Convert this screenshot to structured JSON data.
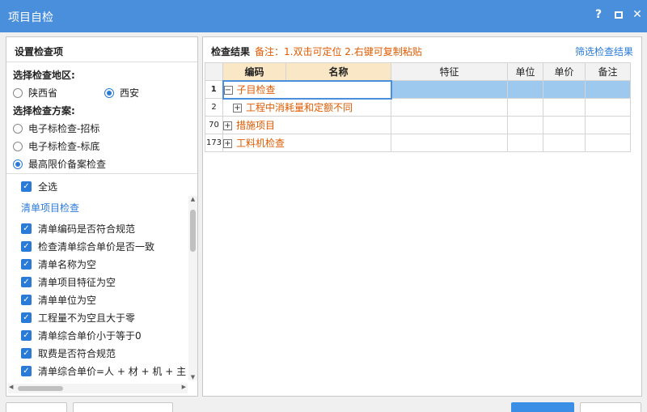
{
  "window": {
    "title": "项目自检",
    "help_label": "?",
    "close_label": "✕"
  },
  "left": {
    "title": "设置检查项",
    "region_label": "选择检查地区:",
    "regions": [
      {
        "label": "陕西省",
        "selected": false
      },
      {
        "label": "西安",
        "selected": true
      }
    ],
    "scheme_label": "选择检查方案:",
    "schemes": [
      {
        "label": "电子标检查-招标",
        "selected": false
      },
      {
        "label": "电子标检查-标底",
        "selected": false
      },
      {
        "label": "最高限价备案检查",
        "selected": true
      }
    ],
    "select_all": "全选",
    "group_title": "清单项目检查",
    "checks": [
      "清单编码是否符合规范",
      "检查清单综合单价是否一致",
      "清单名称为空",
      "清单项目特征为空",
      "清单单位为空",
      "工程量不为空且大于零",
      "清单综合单价小于等于0",
      "取费是否符合规范",
      "清单综合单价=人 + 材 + 机 + 主 +"
    ],
    "scroll_up": "▲",
    "scroll_down": "▼",
    "scroll_left": "◀",
    "scroll_right": "▶"
  },
  "right": {
    "title": "检查结果",
    "note": "备注：1.双击可定位 2.右键可复制粘贴",
    "filter_link": "筛选检查结果",
    "columns": [
      "编码",
      "名称",
      "特征",
      "单位",
      "单价",
      "备注"
    ],
    "rows": [
      {
        "num": "1",
        "sign": "−",
        "name": "子目检查"
      },
      {
        "num": "2",
        "sign": "+",
        "name": "工程中消耗量和定额不同"
      },
      {
        "num": "70",
        "sign": "+",
        "name": "措施项目"
      },
      {
        "num": "173",
        "sign": "+",
        "name": "工料机检查"
      }
    ]
  }
}
